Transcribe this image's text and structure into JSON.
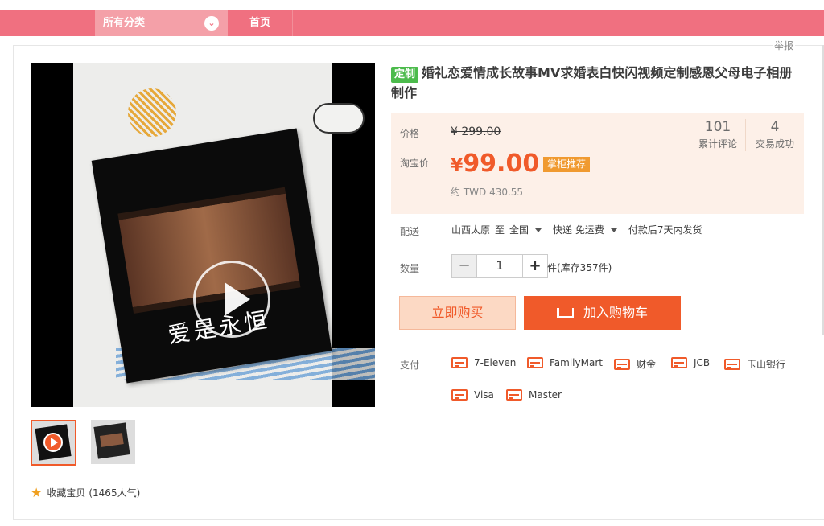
{
  "nav": {
    "category_label": "所有分类",
    "home_label": "首页"
  },
  "report_label": "举报",
  "product": {
    "tag": "定制",
    "title": "婚礼恋爱情成长故事MV求婚表白快闪视频定制感恩父母电子相册制作",
    "image_text": "爱是永恒",
    "price_label": "价格",
    "original_price": "¥ 299.00",
    "taobao_label": "淘宝价",
    "current_currency": "¥",
    "current_price": "99.00",
    "badge": "掌柜推荐",
    "converted_price": "约 TWD 430.55",
    "reviews_count": "101",
    "reviews_label": "累计评论",
    "sales_count": "4",
    "sales_label": "交易成功"
  },
  "shipping": {
    "label": "配送",
    "origin": "山西太原",
    "to": "至",
    "destination": "全国",
    "method": "快递 免运费",
    "delivery": "付款后7天内发货"
  },
  "quantity": {
    "label": "数量",
    "minus": "−",
    "value": "1",
    "plus": "+",
    "stock": "件(库存357件)"
  },
  "actions": {
    "buy_now": "立即购买",
    "add_to_cart": "加入购物车"
  },
  "payment": {
    "label": "支付",
    "methods": [
      "7-Eleven",
      "FamilyMart",
      "财金",
      "JCB",
      "玉山银行",
      "Visa",
      "Master"
    ]
  },
  "favorite": {
    "label": "收藏宝贝",
    "count": "(1465人气)"
  },
  "colors": {
    "accent": "#f05a2a",
    "nav": "#f07080",
    "tag": "#4cbb4c",
    "badge": "#f09a30"
  }
}
